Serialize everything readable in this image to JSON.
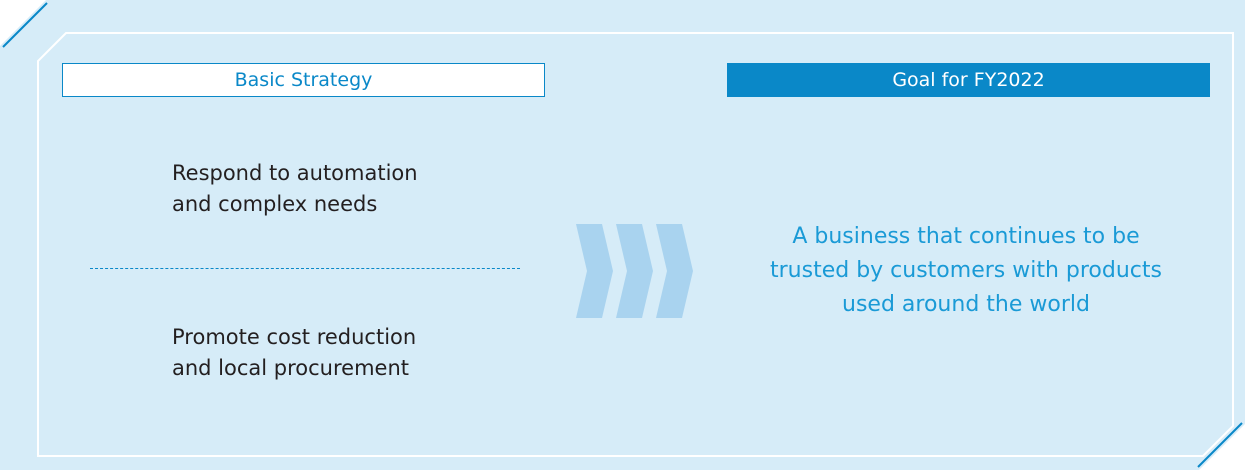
{
  "colors": {
    "panel_background": "#d6ecf8",
    "accent_blue": "#0a88c8",
    "goal_text_blue": "#1a9ad6",
    "chevron_blue": "#a9d3ef",
    "frame_white": "#ffffff",
    "body_text": "#231f20"
  },
  "basic_strategy": {
    "header": "Basic Strategy",
    "items": [
      "Respond to automation\nand complex needs",
      "Promote cost reduction\nand local procurement"
    ]
  },
  "goal": {
    "header": "Goal for FY2022",
    "text": "A business that continues to be\ntrusted by customers with products\nused around the world"
  },
  "icons": {
    "transition": "triple-chevron-right-icon"
  }
}
